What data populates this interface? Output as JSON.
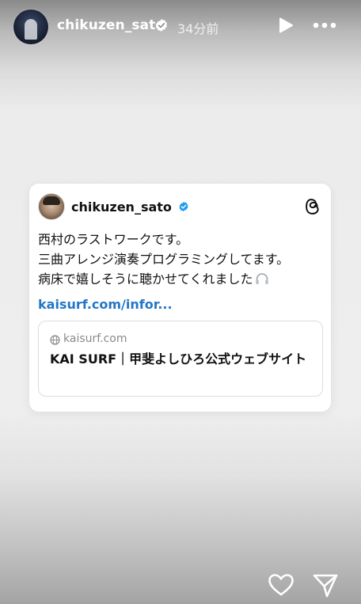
{
  "header": {
    "username": "chikuzen_sato",
    "timestamp": "34分前",
    "icons": [
      "verified-badge-icon",
      "play-icon",
      "more-icon"
    ]
  },
  "post_card": {
    "username": "chikuzen_sato",
    "text_lines": [
      "西村のラストワークです。",
      "三曲アレンジ演奏プログラミングしてます。",
      "病床で嬉しそうに聴かせてくれました"
    ],
    "link_text": "kaisurf.com/infor...",
    "link_preview": {
      "domain": "kaisurf.com",
      "title": "KAI SURF｜甲斐よしひろ公式ウェブサイト"
    },
    "icons": [
      "verified-badge-icon",
      "threads-icon",
      "headphones-icon",
      "globe-icon"
    ]
  },
  "footer": {
    "icons": [
      "heart-icon",
      "send-icon"
    ]
  },
  "colors": {
    "verified": "#1d9bf0",
    "link": "#2377c6"
  }
}
